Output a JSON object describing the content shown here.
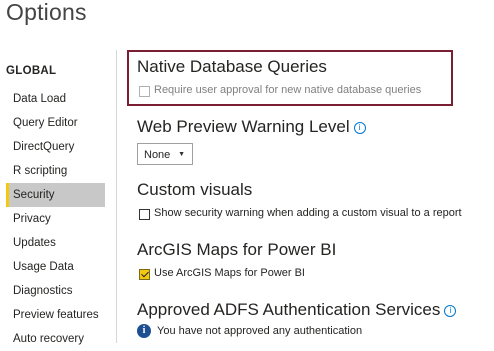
{
  "window": {
    "title": "Options"
  },
  "sidebar": {
    "section": "GLOBAL",
    "items": [
      {
        "label": "Data Load",
        "selected": false
      },
      {
        "label": "Query Editor",
        "selected": false
      },
      {
        "label": "DirectQuery",
        "selected": false
      },
      {
        "label": "R scripting",
        "selected": false
      },
      {
        "label": "Security",
        "selected": true
      },
      {
        "label": "Privacy",
        "selected": false
      },
      {
        "label": "Updates",
        "selected": false
      },
      {
        "label": "Usage Data",
        "selected": false
      },
      {
        "label": "Diagnostics",
        "selected": false
      },
      {
        "label": "Preview features",
        "selected": false
      },
      {
        "label": "Auto recovery",
        "selected": false
      }
    ]
  },
  "main": {
    "native_queries": {
      "heading": "Native Database Queries",
      "checkbox_label": "Require user approval for new native database queries",
      "checked": false,
      "disabled": true
    },
    "web_preview": {
      "heading": "Web Preview Warning Level",
      "info_icon": "info-icon",
      "selected_value": "None"
    },
    "custom_visuals": {
      "heading": "Custom visuals",
      "checkbox_label": "Show security warning when adding a custom visual to a report",
      "checked": false
    },
    "arcgis": {
      "heading": "ArcGIS Maps for Power BI",
      "checkbox_label": "Use ArcGIS Maps for Power BI",
      "checked": true
    },
    "adfs": {
      "heading": "Approved ADFS Authentication Services",
      "info_icon": "info-icon",
      "message": "You have not approved any authentication"
    }
  },
  "colors": {
    "accent": "#f2c811",
    "highlight_border": "#7a1f33",
    "selected_bg": "#c8c8c8",
    "info_blue": "#0078d4"
  }
}
